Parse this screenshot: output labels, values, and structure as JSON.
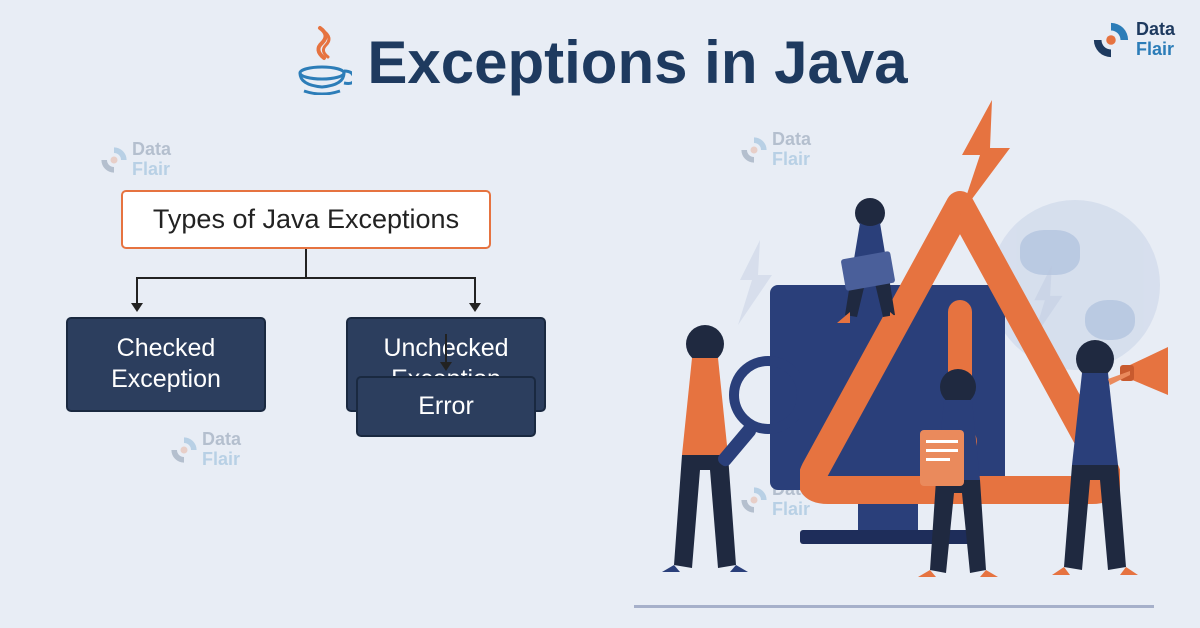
{
  "title": "Exceptions in Java",
  "brand": {
    "name1": "Data",
    "name2": "Flair"
  },
  "diagram": {
    "parent": "Types of Java Exceptions",
    "children": [
      {
        "label": "Checked Exception"
      },
      {
        "label": "Unchecked Exception",
        "sub": {
          "label": "Error"
        }
      }
    ]
  },
  "colors": {
    "accent": "#e67340",
    "box": "#2c3e5e",
    "title": "#1e3a5f",
    "bg": "#e8edf5"
  }
}
